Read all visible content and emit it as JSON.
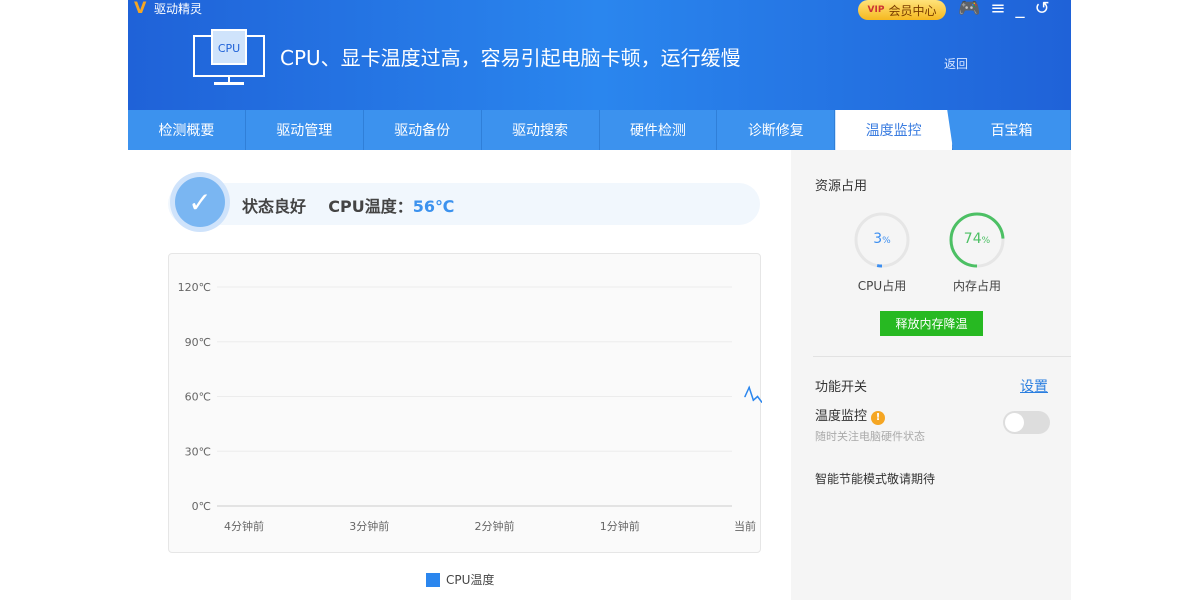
{
  "header": {
    "app_name": "驱动精灵",
    "vip_label": "会员中心",
    "vip_badge": "VIP",
    "headline": "CPU、显卡温度过高，容易引起电脑卡顿，运行缓慢",
    "back_label": "返回",
    "monitor_label": "CPU"
  },
  "tabs": [
    {
      "label": "检测概要"
    },
    {
      "label": "驱动管理"
    },
    {
      "label": "驱动备份"
    },
    {
      "label": "驱动搜索"
    },
    {
      "label": "硬件检测"
    },
    {
      "label": "诊断修复"
    },
    {
      "label": "温度监控",
      "active": true
    },
    {
      "label": "百宝箱"
    }
  ],
  "status": {
    "state": "状态良好",
    "cpu_temp_label": "CPU温度：",
    "cpu_temp_value": "56℃"
  },
  "chart_data": {
    "type": "line",
    "title": "",
    "xlabel": "",
    "ylabel": "",
    "ylim": [
      0,
      120
    ],
    "yticks": [
      "0℃",
      "30℃",
      "60℃",
      "90℃",
      "120℃"
    ],
    "ytick_values": [
      0,
      30,
      60,
      90,
      120
    ],
    "xticks": [
      "4分钟前",
      "3分钟前",
      "2分钟前",
      "1分钟前",
      "当前"
    ],
    "xtick_values": [
      -240,
      -180,
      -120,
      -60,
      0
    ],
    "xlim": [
      -240,
      0
    ],
    "grid": true,
    "legend": "bottom",
    "series": [
      {
        "name": "CPU温度",
        "color": "#2b86ee",
        "x": [
          0,
          2,
          4,
          6,
          8,
          10
        ],
        "y": [
          60,
          65,
          58,
          60,
          57,
          56
        ]
      }
    ]
  },
  "resources": {
    "title": "资源占用",
    "cpu": {
      "value": 3,
      "text": "3",
      "unit": "%",
      "label": "CPU占用",
      "color": "#3c8ef0"
    },
    "memory": {
      "value": 74,
      "text": "74",
      "unit": "%",
      "label": "内存占用",
      "color": "#4cc064"
    },
    "release_button": "释放内存降温"
  },
  "features": {
    "title": "功能开关",
    "settings_link": "设置",
    "temp_monitor": {
      "label": "温度监控",
      "warn": "!",
      "desc": "随时关注电脑硬件状态",
      "enabled": false
    },
    "smart_mode": "智能节能模式敬请期待"
  }
}
